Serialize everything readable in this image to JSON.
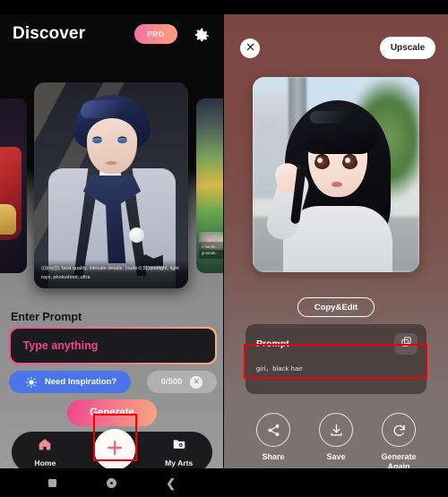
{
  "left": {
    "header": {
      "title": "Discover",
      "pro_label": "PRO",
      "settings_icon": "gear-icon"
    },
    "carousel": {
      "main_card": {
        "caption": "(((boy))), best quality, intricate details, (nude:0.5),spotlight, light rays, photoshoot, ultra"
      },
      "side_card_right": {
        "caption": "A hands... grounds..."
      }
    },
    "prompt_section": {
      "label": "Enter Prompt",
      "placeholder": "Type anything",
      "value": "",
      "inspiration_label": "Need Inspiration?",
      "inspiration_icon": "lightbulb-icon",
      "counter": "0/500",
      "clear_icon": "close-icon",
      "generate_label": "Generate"
    },
    "bottom_nav": {
      "items": [
        {
          "label": "Home",
          "icon": "home-icon"
        },
        {
          "label": "My Arts",
          "icon": "folder-photo-icon"
        }
      ],
      "fab_icon": "plus-icon"
    }
  },
  "right": {
    "header": {
      "close_icon": "close-icon",
      "upscale_label": "Upscale"
    },
    "copy_edit_label": "Copy&Edit",
    "prompt_card": {
      "title": "Prompt",
      "copy_icon": "copy-icon",
      "value": "girl，black hair"
    },
    "actions": [
      {
        "label": "Share",
        "icon": "share-icon"
      },
      {
        "label": "Save",
        "icon": "download-icon"
      },
      {
        "label": "Generate\nAgain",
        "icon": "refresh-icon"
      }
    ]
  },
  "system_nav": {
    "recents_icon": "square-icon",
    "home_icon": "circle-icon",
    "back_icon": "chevron-left-icon"
  },
  "annotations": {
    "color": "#f00000",
    "targets": [
      "create-fab",
      "prompt-value-field"
    ]
  },
  "colors": {
    "accent_pink": "#f0488f",
    "accent_peach": "#f6a77e",
    "inspiration_blue": "#4b74e8",
    "right_panel_top": "#7b4743",
    "right_panel_bottom": "#7c7371"
  }
}
